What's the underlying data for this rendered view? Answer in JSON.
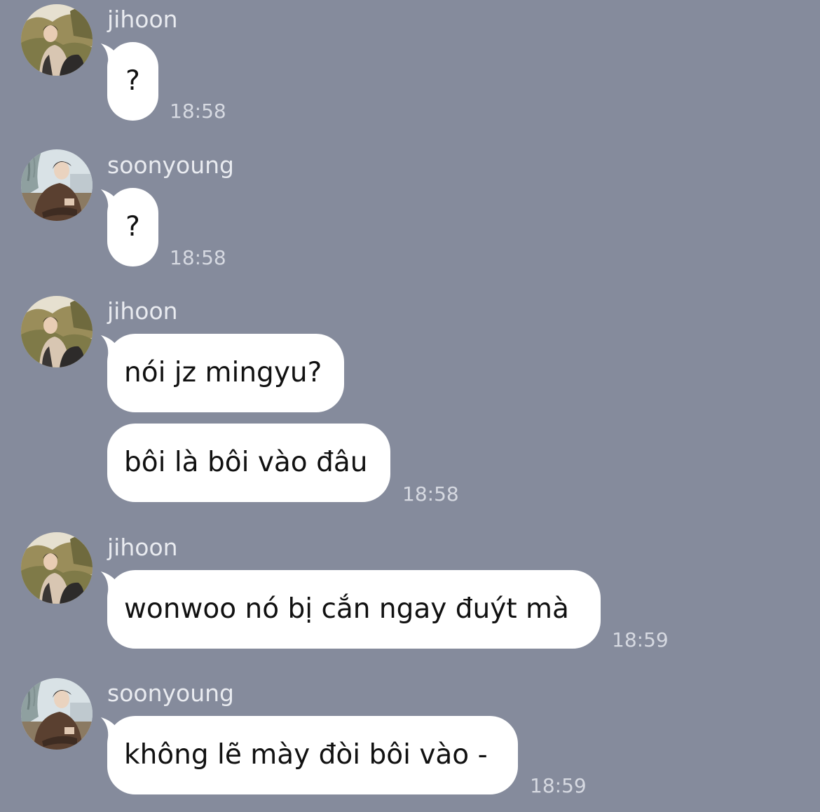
{
  "messages": [
    {
      "sender": "jihoon",
      "avatar_icon": "jihoon-avatar",
      "bubbles": [
        "?"
      ],
      "time": "18:58"
    },
    {
      "sender": "soonyoung",
      "avatar_icon": "soonyoung-avatar",
      "bubbles": [
        "?"
      ],
      "time": "18:58"
    },
    {
      "sender": "jihoon",
      "avatar_icon": "jihoon-avatar",
      "bubbles": [
        "nói jz mingyu?",
        "bôi là bôi vào đâu"
      ],
      "time": "18:58"
    },
    {
      "sender": "jihoon",
      "avatar_icon": "jihoon-avatar",
      "bubbles": [
        "wonwoo nó bị cắn ngay đuýt mà"
      ],
      "time": "18:59"
    },
    {
      "sender": "soonyoung",
      "avatar_icon": "soonyoung-avatar",
      "bubbles": [
        "không lẽ mày đòi bôi vào -"
      ],
      "time": "18:59"
    }
  ],
  "colors": {
    "background": "#858b9c",
    "bubble": "#ffffff",
    "sender_text": "#e9ebf0",
    "time_text": "#d6d9e1"
  }
}
